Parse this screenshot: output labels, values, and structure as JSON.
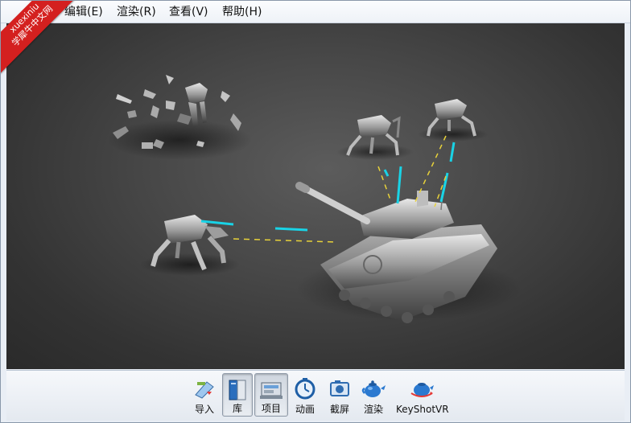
{
  "watermark": {
    "line1": "xuexiniu",
    "line2": "学犀牛中文网"
  },
  "menubar": {
    "items": [
      {
        "label": ")"
      },
      {
        "label": "编辑(E)"
      },
      {
        "label": "渲染(R)"
      },
      {
        "label": "查看(V)"
      },
      {
        "label": "帮助(H)"
      }
    ]
  },
  "toolbar": {
    "buttons": [
      {
        "label": "导入",
        "icon": "import-icon",
        "pressed": false
      },
      {
        "label": "库",
        "icon": "library-icon",
        "pressed": true
      },
      {
        "label": "项目",
        "icon": "project-icon",
        "pressed": true
      },
      {
        "label": "动画",
        "icon": "animation-icon",
        "pressed": false
      },
      {
        "label": "截屏",
        "icon": "screenshot-icon",
        "pressed": false
      },
      {
        "label": "渲染",
        "icon": "render-teapot-icon",
        "pressed": false
      },
      {
        "label": "KeyShotVR",
        "icon": "keyshotvr-icon",
        "pressed": false
      }
    ]
  },
  "colors": {
    "viewport_bg": "#474747",
    "laser_cyan": "#19d3e6",
    "laser_yellow": "#e8d23a",
    "watermark_red": "#d4201f"
  }
}
